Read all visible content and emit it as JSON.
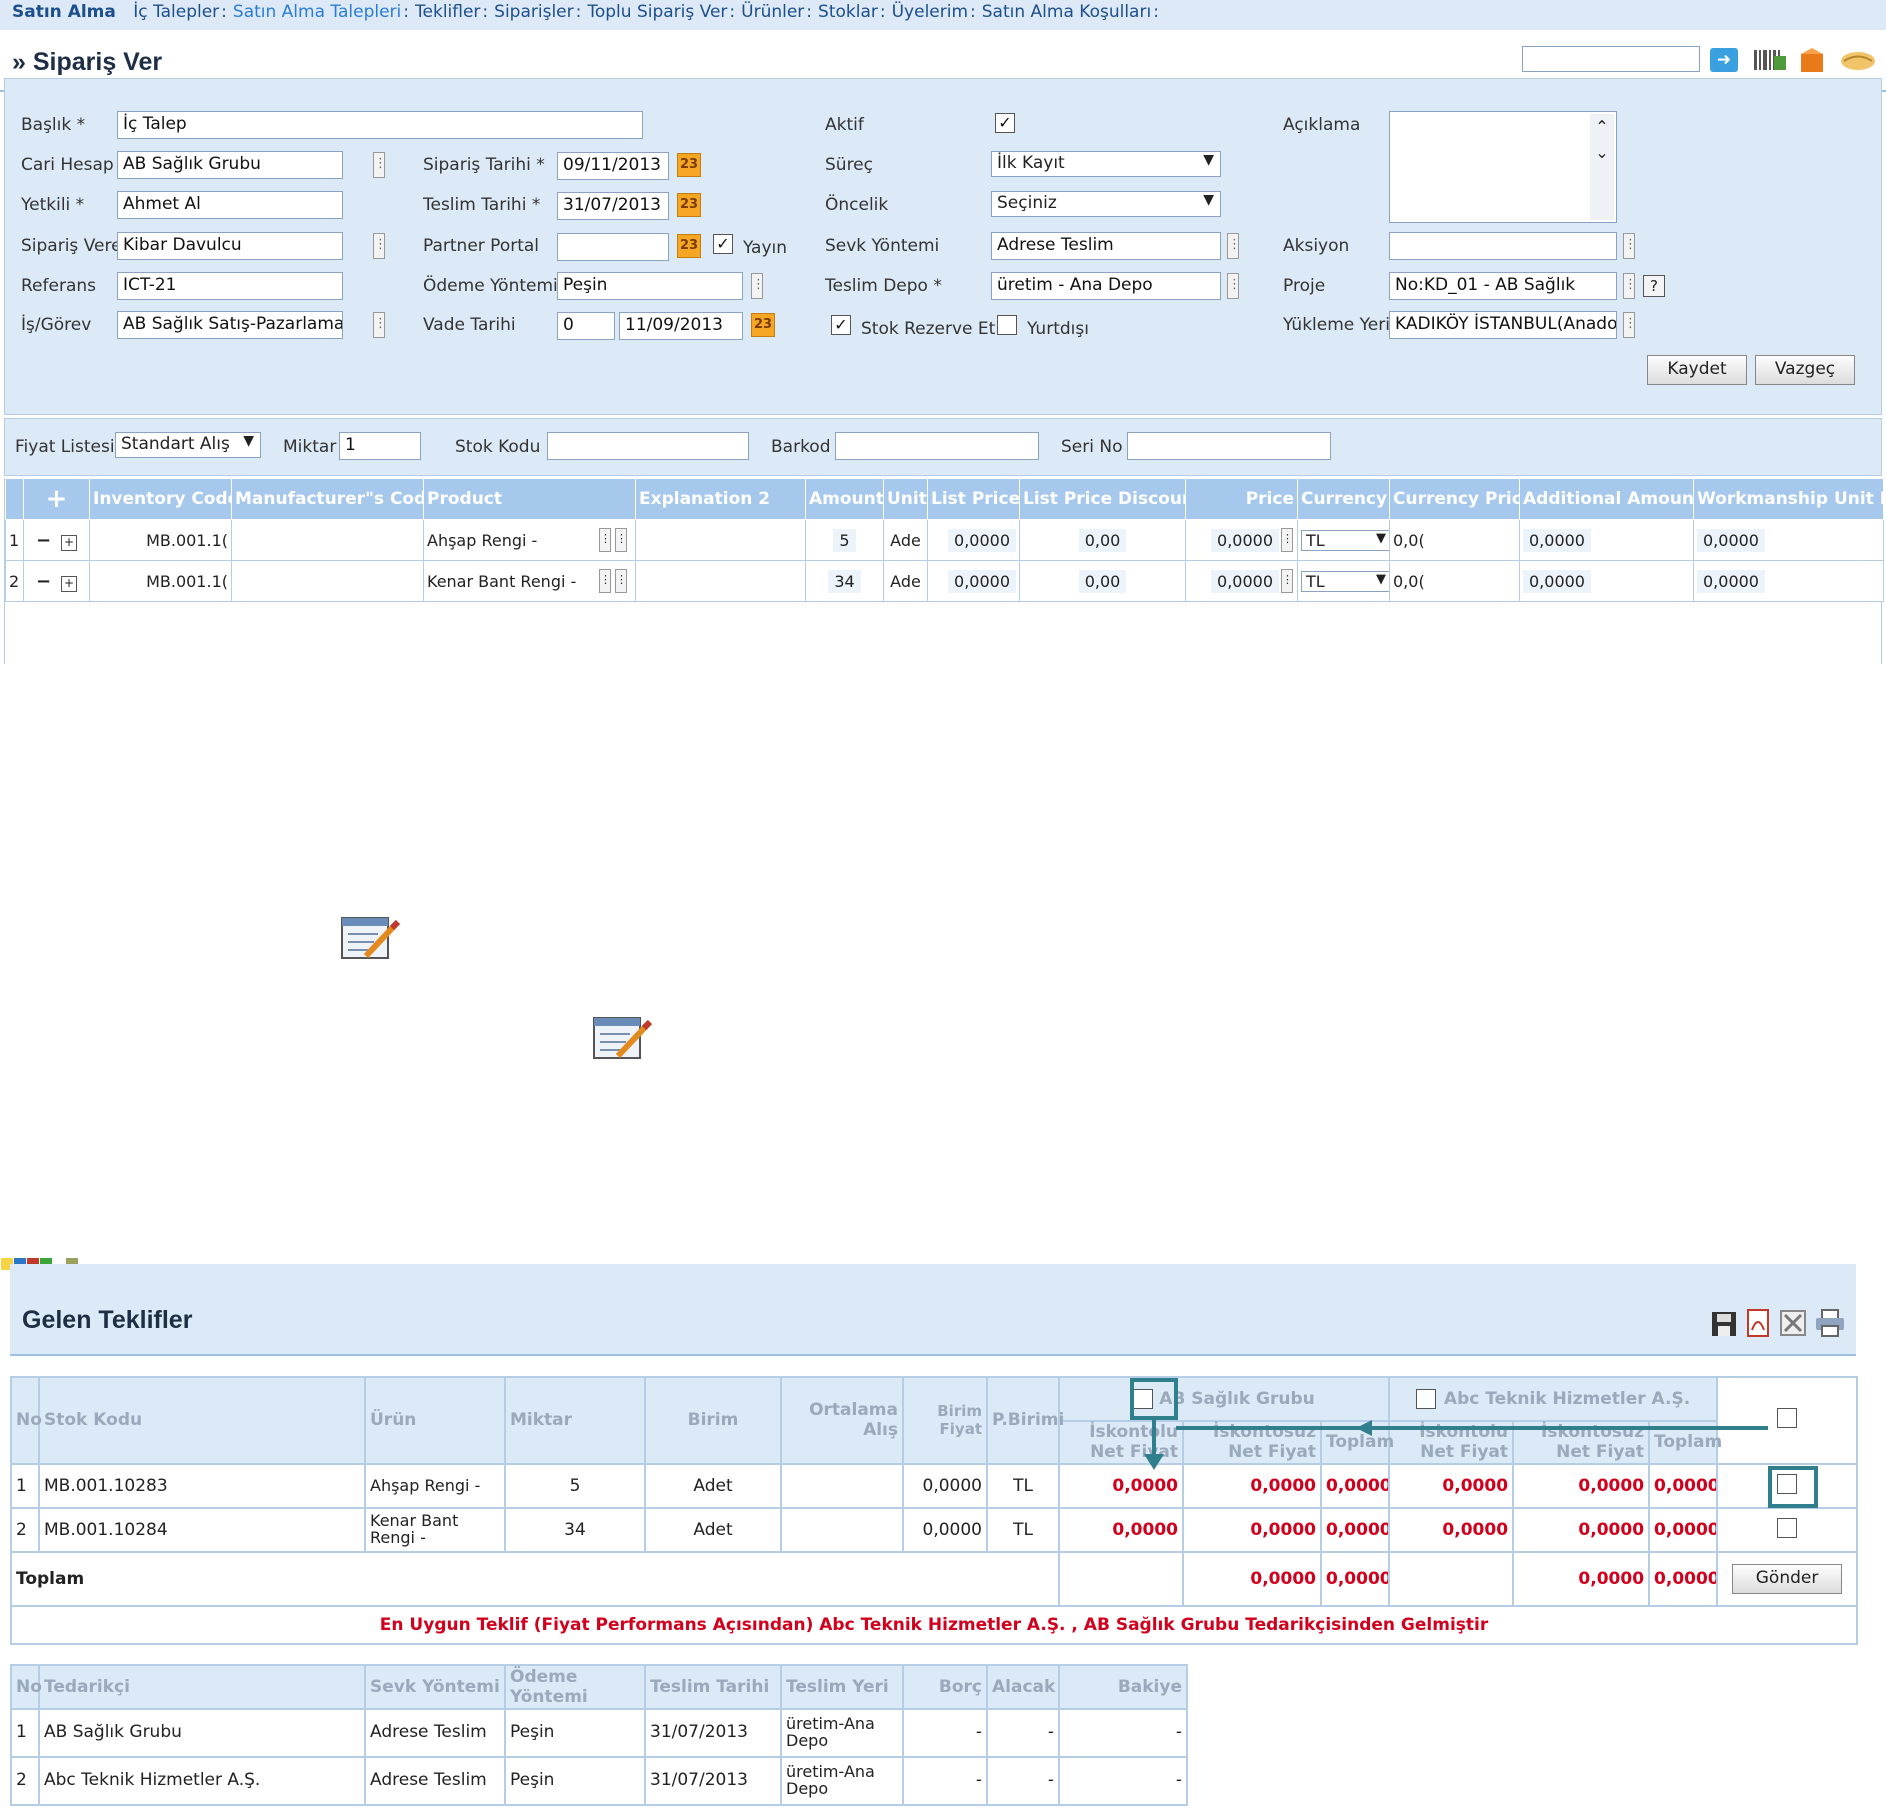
{
  "topnav": {
    "brand": "Satın Alma",
    "items": [
      {
        "label": "İç Talepler",
        "active": false
      },
      {
        "label": "Satın Alma Talepleri",
        "active": true
      },
      {
        "label": "Teklifler",
        "active": false
      },
      {
        "label": "Siparişler",
        "active": false
      },
      {
        "label": "Toplu Sipariş Ver",
        "active": false
      },
      {
        "label": "Ürünler",
        "active": false
      },
      {
        "label": "Stoklar",
        "active": false
      },
      {
        "label": "Üyelerim",
        "active": false
      },
      {
        "label": "Satın Alma Koşulları",
        "active": false
      }
    ],
    "separator": ":"
  },
  "page": {
    "title": "» Sipariş Ver"
  },
  "form": {
    "baslik_label": "Başlık *",
    "baslik_value": "İç Talep",
    "cari_label": "Cari Hesap *",
    "cari_value": "AB Sağlık Grubu",
    "yetkili_label": "Yetkili *",
    "yetkili_value": "Ahmet Al",
    "siparis_veren_label": "Sipariş Veren",
    "siparis_veren_value": "Kibar Davulcu",
    "referans_label": "Referans",
    "referans_value": "ICT-21",
    "isgorev_label": "İş/Görev",
    "isgorev_value": "AB Sağlık Satış-Pazarlama",
    "siparis_tarihi_label": "Sipariş Tarihi *",
    "siparis_tarihi_value": "09/11/2013",
    "teslim_tarihi_label": "Teslim Tarihi *",
    "teslim_tarihi_value": "31/07/2013",
    "partner_portal_label": "Partner Portal",
    "partner_portal_value": "",
    "yayin_label": "Yayın",
    "odeme_label": "Ödeme Yöntemi",
    "odeme_value": "Peşin",
    "vade_label": "Vade Tarihi",
    "vade_days": "0",
    "vade_date": "11/09/2013",
    "calendar_text": "23",
    "aktif_label": "Aktif",
    "surec_label": "Süreç",
    "surec_value": "İlk Kayıt",
    "oncelik_label": "Öncelik",
    "oncelik_value": "Seçiniz",
    "sevk_label": "Sevk Yöntemi",
    "sevk_value": "Adrese Teslim",
    "teslim_depo_label": "Teslim Depo *",
    "teslim_depo_value": "üretim - Ana Depo",
    "stok_rezerve_label": "Stok Rezerve Et",
    "yurtdisi_label": "Yurtdışı",
    "aciklama_label": "Açıklama",
    "aksiyon_label": "Aksiyon",
    "aksiyon_value": "",
    "proje_label": "Proje",
    "proje_value": "No:KD_01 - AB Sağlık",
    "yukleme_label": "Yükleme Yeri",
    "yukleme_value": "KADIKÖY İSTANBUL(Anado",
    "save_label": "Kaydet",
    "cancel_label": "Vazgeç",
    "help_text": "?"
  },
  "filter": {
    "fiyat_listesi_label": "Fiyat Listesi",
    "fiyat_listesi_value": "Standart Alış",
    "miktar_label": "Miktar",
    "miktar_value": "1",
    "stok_kodu_label": "Stok Kodu",
    "barkod_label": "Barkod",
    "seri_no_label": "Seri No"
  },
  "lines": {
    "add_symbol": "+",
    "headers": [
      "Inventory Code",
      "Manufacturer\"s Code",
      "Product",
      "Explanation 2",
      "Amount",
      "Unit",
      "List Price",
      "List Price Discount",
      "Price",
      "Currency",
      "Currency Price",
      "Additional Amount",
      "Workmanship Unit Pri"
    ],
    "rows": [
      {
        "no": "1",
        "inventory_code": "MB.001.1(",
        "manufacturer_code": "",
        "product": "Ahşap Rengi -",
        "explanation": "",
        "amount": "5",
        "unit": "Ade",
        "list_price": "0,0000",
        "discount": "0,00",
        "price": "0,0000",
        "currency": "TL",
        "currency_price": "0,0(",
        "additional": "0,0000",
        "workmanship": "0,0000"
      },
      {
        "no": "2",
        "inventory_code": "MB.001.1(",
        "manufacturer_code": "",
        "product": "Kenar Bant Rengi -",
        "explanation": "",
        "amount": "34",
        "unit": "Ade",
        "list_price": "0,0000",
        "discount": "0,00",
        "price": "0,0000",
        "currency": "TL",
        "currency_price": "0,0(",
        "additional": "0,0000",
        "workmanship": "0,0000"
      }
    ]
  },
  "offers": {
    "title": "Gelen Teklifler",
    "headers": {
      "no": "No",
      "stok_kodu": "Stok Kodu",
      "urun": "Ürün",
      "miktar": "Miktar",
      "birim": "Birim",
      "ortalama": "Ortalama Alış",
      "birim_fiyat": "Birim Fiyat",
      "pbirimi": "P.Birimi",
      "supplier1": "AB Sağlık Grubu",
      "supplier2": "Abc Teknik Hizmetler A.Ş.",
      "iskontolu": "İskontolu Net Fiyat",
      "iskontosuz": "İskontosuz Net Fiyat",
      "toplam": "Toplam"
    },
    "rows": [
      {
        "no": "1",
        "stok_kodu": "MB.001.10283",
        "urun": "Ahşap Rengi -",
        "miktar": "5",
        "birim": "Adet",
        "ortalama": "",
        "birim_fiyat": "0,0000",
        "pbirimi": "TL",
        "s1_isk": "0,0000",
        "s1_iskz": "0,0000",
        "s1_top": "0,0000",
        "s2_isk": "0,0000",
        "s2_iskz": "0,0000",
        "s2_top": "0,0000"
      },
      {
        "no": "2",
        "stok_kodu": "MB.001.10284",
        "urun": "Kenar Bant Rengi -",
        "miktar": "34",
        "birim": "Adet",
        "ortalama": "",
        "birim_fiyat": "0,0000",
        "pbirimi": "TL",
        "s1_isk": "0,0000",
        "s1_iskz": "0,0000",
        "s1_top": "0,0000",
        "s2_isk": "0,0000",
        "s2_iskz": "0,0000",
        "s2_top": "0,0000"
      }
    ],
    "total_label": "Toplam",
    "totals": {
      "s1_iskz": "0,0000",
      "s1_top": "0,0000",
      "s2_iskz": "0,0000",
      "s2_top": "0,0000"
    },
    "send_label": "Gönder",
    "best_offer_note": "En Uygun Teklif (Fiyat Performans Açısından) Abc Teknik Hizmetler A.Ş. , AB Sağlık Grubu Tedarikçisinden Gelmiştir"
  },
  "suppliers": {
    "headers": [
      "No",
      "Tedarikçi",
      "Sevk Yöntemi",
      "Ödeme Yöntemi",
      "Teslim Tarihi",
      "Teslim Yeri",
      "Borç",
      "Alacak",
      "Bakiye"
    ],
    "rows": [
      {
        "no": "1",
        "name": "AB Sağlık Grubu",
        "sevk": "Adrese Teslim",
        "odeme": "Peşin",
        "tarih": "31/07/2013",
        "yer": "üretim-Ana Depo",
        "borc": "-",
        "alacak": "-",
        "bakiye": "-"
      },
      {
        "no": "2",
        "name": "Abc Teknik Hizmetler A.Ş.",
        "sevk": "Adrese Teslim",
        "odeme": "Peşin",
        "tarih": "31/07/2013",
        "yer": "üretim-Ana Depo",
        "borc": "-",
        "alacak": "-",
        "bakiye": "-"
      }
    ]
  },
  "colors": {
    "accent": "#2a7dd6",
    "panel": "#dce9f6",
    "header": "#a6c8ec",
    "alert": "#d1001c",
    "highlight": "#2f7f8c"
  },
  "icons": [
    "arrow-right-icon",
    "barcode-icon",
    "box-icon",
    "handshake-icon",
    "save-icon",
    "pdf-icon",
    "excel-icon",
    "print-icon",
    "edit-note-icon"
  ]
}
